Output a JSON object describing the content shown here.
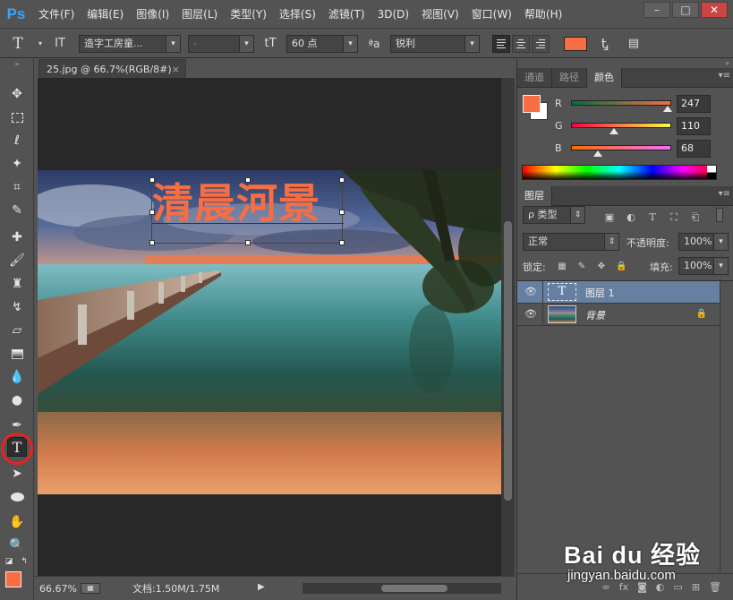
{
  "app": {
    "logo": "Ps",
    "menu": [
      "文件(F)",
      "编辑(E)",
      "图像(I)",
      "图层(L)",
      "类型(Y)",
      "选择(S)",
      "滤镜(T)",
      "3D(D)",
      "视图(V)",
      "窗口(W)",
      "帮助(H)"
    ],
    "window_controls": [
      "–",
      "□",
      "✕"
    ]
  },
  "options": {
    "tool_glyph": "T",
    "orient_glyph": "IT",
    "font_family": "造字工房童...",
    "font_style": "-",
    "size_glyph": "tT",
    "font_size": "60 点",
    "aa_glyph": "ªa",
    "antialias": "锐利",
    "text_color": "#f76e44"
  },
  "document": {
    "tab_title": "25.jpg @ 66.7%(RGB/8#)",
    "text_layer": "清晨河景",
    "text_color": "#f76e44"
  },
  "status": {
    "zoom": "66.67%",
    "doc_size": "文档:1.50M/1.75M"
  },
  "color_panel": {
    "tabs": [
      "通道",
      "路径",
      "颜色"
    ],
    "active_tab": "颜色",
    "r_label": "R",
    "r_value": "247",
    "r": 247,
    "g_label": "G",
    "g_value": "110",
    "g": 110,
    "b_label": "B",
    "b_value": "68",
    "b": 68,
    "fg": "#f76e44",
    "bg": "#ffffff"
  },
  "layers_panel": {
    "tab": "图层",
    "filter_label": "ρ 类型",
    "blend_mode": "正常",
    "opacity_label": "不透明度:",
    "opacity_value": "100%",
    "lock_label": "锁定:",
    "fill_label": "填充:",
    "fill_value": "100%",
    "layers": [
      {
        "name": "图层 1",
        "type": "text",
        "selected": true,
        "locked": false
      },
      {
        "name": "背景",
        "type": "image",
        "selected": false,
        "locked": true
      }
    ]
  },
  "watermark": {
    "brand": "Bai du 经验",
    "url": "jingyan.baidu.com"
  }
}
